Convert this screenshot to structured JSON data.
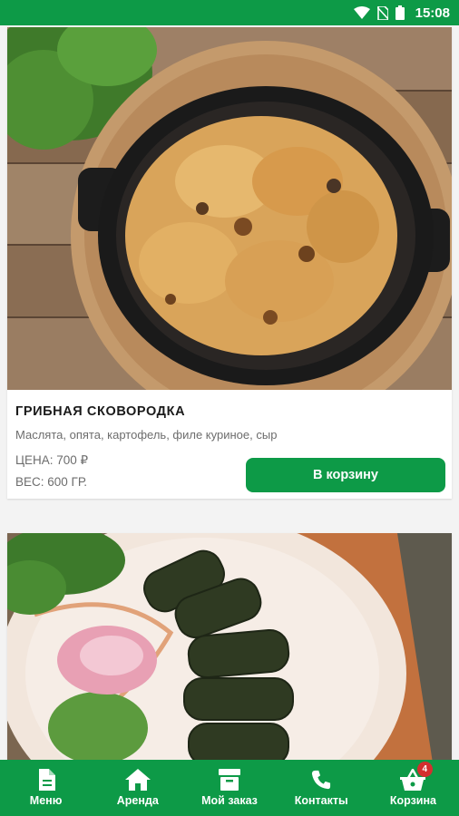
{
  "status_bar": {
    "time": "15:08"
  },
  "dishes": [
    {
      "title": "ГРИБНАЯ СКОВОРОДКА",
      "description": "Маслята, опята, картофель, филе куриное, сыр",
      "price": "ЦЕНА: 700 ₽",
      "weight": "ВЕС: 600 ГР.",
      "button_label": "В корзину"
    }
  ],
  "nav": {
    "items": [
      {
        "label": "Меню",
        "icon": "document-icon"
      },
      {
        "label": "Аренда",
        "icon": "home-icon"
      },
      {
        "label": "Мой заказ",
        "icon": "archive-box-icon"
      },
      {
        "label": "Контакты",
        "icon": "phone-icon"
      },
      {
        "label": "Корзина",
        "icon": "shopping-basket-icon",
        "badge": "4"
      }
    ]
  },
  "colors": {
    "primary": "#0d9a47",
    "badge": "#d32f2f"
  }
}
